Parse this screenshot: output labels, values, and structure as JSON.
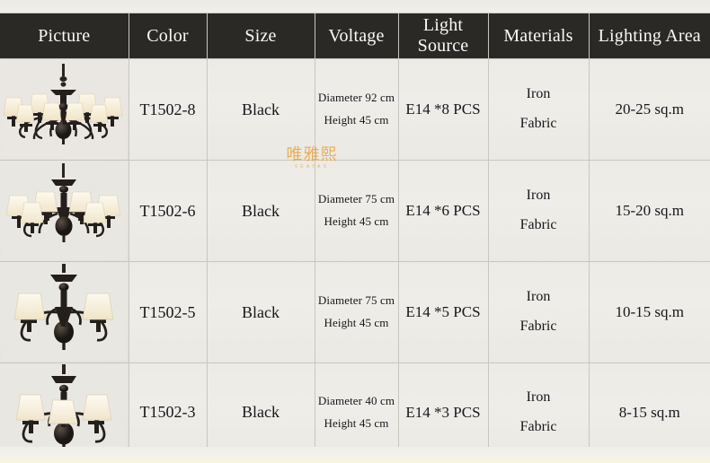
{
  "table": {
    "columns": [
      {
        "key": "picture",
        "label": "Picture"
      },
      {
        "key": "color",
        "label": "Color"
      },
      {
        "key": "size",
        "label": "Size"
      },
      {
        "key": "voltage",
        "label": "Voltage"
      },
      {
        "key": "light_source",
        "label": "Light Source"
      },
      {
        "key": "materials",
        "label": "Materials"
      },
      {
        "key": "lighting_area",
        "label": "Lighting Area"
      }
    ],
    "rows": [
      {
        "model": "T1502-8",
        "color": "Black",
        "diameter": "Diameter 92 cm",
        "height": "Height 45 cm",
        "light_source": "E14 *8 PCS",
        "material_1": "Iron",
        "material_2": "Fabric",
        "lighting_area": "20-25 sq.m",
        "picture_alt": "black-8-arm-chandelier"
      },
      {
        "model": "T1502-6",
        "color": "Black",
        "diameter": "Diameter 75 cm",
        "height": "Height 45 cm",
        "light_source": "E14 *6 PCS",
        "material_1": "Iron",
        "material_2": "Fabric",
        "lighting_area": "15-20 sq.m",
        "picture_alt": "black-6-arm-chandelier"
      },
      {
        "model": "T1502-5",
        "color": "Black",
        "diameter": "Diameter 75 cm",
        "height": "Height 45 cm",
        "light_source": "E14 *5 PCS",
        "material_1": "Iron",
        "material_2": "Fabric",
        "lighting_area": "10-15 sq.m",
        "picture_alt": "black-5-arm-chandelier"
      },
      {
        "model": "T1502-3",
        "color": "Black",
        "diameter": "Diameter 40 cm",
        "height": "Height 45 cm",
        "light_source": "E14 *3 PCS",
        "material_1": "Iron",
        "material_2": "Fabric",
        "lighting_area": "8-15 sq.m",
        "picture_alt": "black-3-arm-chandelier"
      }
    ]
  },
  "watermark": {
    "chinese": "唯雅熙",
    "latin": "VEAYAS",
    "color": "#e8a33d"
  },
  "colors": {
    "header_bg": "#2b2926",
    "header_text": "#fbfaf7",
    "cell_bg": "#eeece7",
    "grid_line": "#c9c6c0",
    "page_bg": "#f1efea",
    "fixture_metal": "#231f1d",
    "shade_cream": "#f6eedb"
  }
}
